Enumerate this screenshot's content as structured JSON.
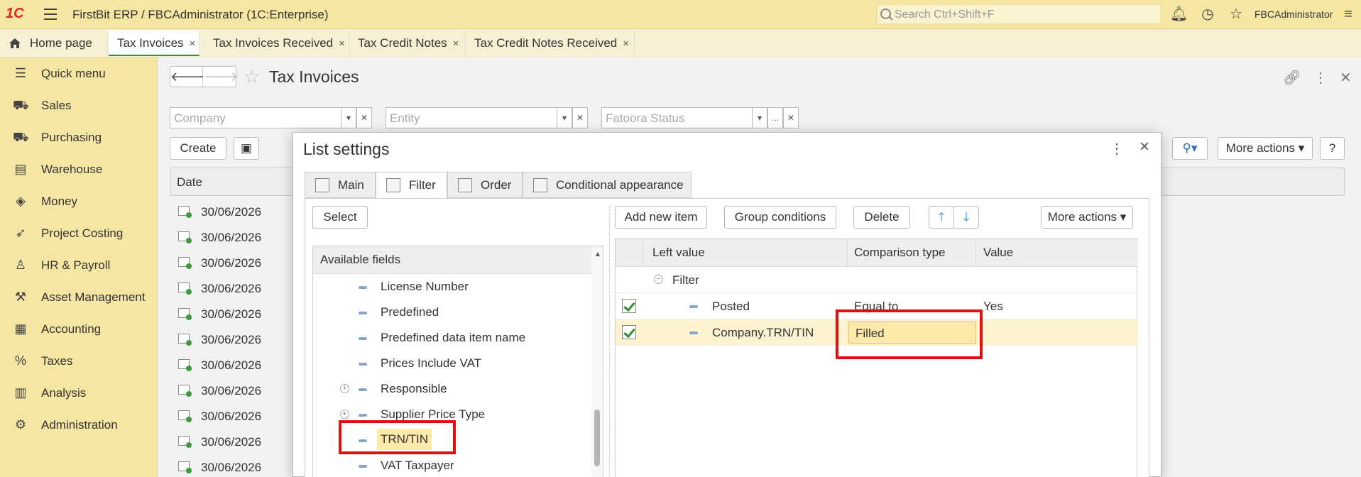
{
  "app": {
    "title": "FirstBit ERP / FBCAdministrator  (1C:Enterprise)",
    "search_placeholder": "Search Ctrl+Shift+F",
    "user": "FBCAdministrator"
  },
  "tabs": {
    "home": "Home page",
    "items": [
      "Tax Invoices",
      "Tax Invoices Received",
      "Tax Credit Notes",
      "Tax Credit Notes Received"
    ],
    "close": "×"
  },
  "sidebar": {
    "items": [
      {
        "label": "Quick menu",
        "icon": "menu-icon"
      },
      {
        "label": "Sales",
        "icon": "basket-icon"
      },
      {
        "label": "Purchasing",
        "icon": "truck-icon"
      },
      {
        "label": "Warehouse",
        "icon": "warehouse-icon"
      },
      {
        "label": "Money",
        "icon": "money-icon"
      },
      {
        "label": "Project Costing",
        "icon": "rocket-icon"
      },
      {
        "label": "HR & Payroll",
        "icon": "person-icon"
      },
      {
        "label": "Asset Management",
        "icon": "crane-icon"
      },
      {
        "label": "Accounting",
        "icon": "ledger-icon"
      },
      {
        "label": "Taxes",
        "icon": "percent-icon"
      },
      {
        "label": "Analysis",
        "icon": "chart-icon"
      },
      {
        "label": "Administration",
        "icon": "gear-icon"
      }
    ]
  },
  "form": {
    "title": "Tax Invoices",
    "filters": {
      "company_placeholder": "Company",
      "entity_placeholder": "Entity",
      "fatoora_placeholder": "Fatoora Status"
    },
    "create_label": "Create",
    "more_actions_label": "More actions",
    "help_label": "?",
    "column_date": "Date",
    "dates": [
      "30/06/2026",
      "30/06/2026",
      "30/06/2026",
      "30/06/2026",
      "30/06/2026",
      "30/06/2026",
      "30/06/2026",
      "30/06/2026",
      "30/06/2026",
      "30/06/2026",
      "30/06/2026"
    ]
  },
  "dialog": {
    "title": "List settings",
    "tabs": [
      "Main",
      "Filter",
      "Order",
      "Conditional appearance"
    ],
    "select_label": "Select",
    "available_fields_header": "Available fields",
    "fields": [
      {
        "label": "License Number",
        "expandable": false
      },
      {
        "label": "Predefined",
        "expandable": false
      },
      {
        "label": "Predefined data item name",
        "expandable": false
      },
      {
        "label": "Prices Include VAT",
        "expandable": false
      },
      {
        "label": "Responsible",
        "expandable": true
      },
      {
        "label": "Supplier Price Type",
        "expandable": true
      },
      {
        "label": "TRN/TIN",
        "expandable": false
      },
      {
        "label": "VAT Taxpayer",
        "expandable": false
      }
    ],
    "toolbar": {
      "add_new_item": "Add new item",
      "group_conditions": "Group conditions",
      "delete": "Delete",
      "more_actions": "More actions"
    },
    "grid": {
      "headers": [
        "Left value",
        "Comparison type",
        "Value"
      ],
      "group_label": "Filter",
      "rows": [
        {
          "checked": true,
          "left": "Posted",
          "comparison": "Equal to",
          "value": "Yes"
        },
        {
          "checked": true,
          "left": "Company.TRN/TIN",
          "comparison": "Filled",
          "value": ""
        }
      ]
    }
  },
  "colors": {
    "header_bg": "#f5e6a3",
    "highlight_bg": "#fde9a8",
    "annotation_red": "#e01010",
    "check_green": "#2f8f2f"
  }
}
